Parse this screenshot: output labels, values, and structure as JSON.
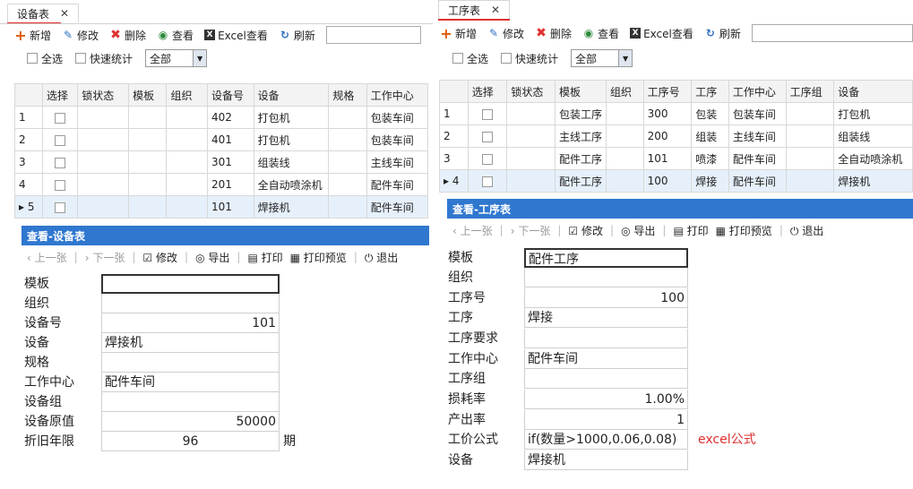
{
  "left": {
    "tab": {
      "title": "设备表",
      "close": "✕"
    },
    "toolbar": {
      "add": "新增",
      "edit": "修改",
      "delete": "删除",
      "view": "查看",
      "excel": "Excel查看",
      "refresh": "刷新"
    },
    "filters": {
      "select_all": "全选",
      "quick_stats": "快速统计",
      "dropdown": "全部"
    },
    "grid": {
      "headers": [
        "",
        "选择",
        "锁状态",
        "模板",
        "组织",
        "设备号",
        "设备",
        "规格",
        "工作中心"
      ],
      "rows": [
        {
          "no": "1",
          "code": "402",
          "name": "打包机",
          "spec": "",
          "center": "包装车间"
        },
        {
          "no": "2",
          "code": "401",
          "name": "打包机",
          "spec": "",
          "center": "包装车间"
        },
        {
          "no": "3",
          "code": "301",
          "name": "组装线",
          "spec": "",
          "center": "主线车间"
        },
        {
          "no": "4",
          "code": "201",
          "name": "全自动喷涂机",
          "spec": "",
          "center": "配件车间"
        },
        {
          "no": "5",
          "code": "101",
          "name": "焊接机",
          "spec": "",
          "center": "配件车间"
        }
      ]
    },
    "dialog": {
      "title": "查看-设备表",
      "nav": {
        "prev": "上一张",
        "next": "下一张",
        "edit": "修改",
        "export": "导出",
        "print": "打印",
        "preview": "打印预览",
        "exit": "退出"
      },
      "fields": [
        {
          "label": "模板",
          "value": ""
        },
        {
          "label": "组织",
          "value": ""
        },
        {
          "label": "设备号",
          "value": "101"
        },
        {
          "label": "设备",
          "value": "焊接机"
        },
        {
          "label": "规格",
          "value": ""
        },
        {
          "label": "工作中心",
          "value": "配件车间"
        },
        {
          "label": "设备组",
          "value": ""
        },
        {
          "label": "设备原值",
          "value": "50000"
        },
        {
          "label": "折旧年限",
          "value": "96"
        }
      ],
      "suffix": "期"
    }
  },
  "right": {
    "tab": {
      "title": "工序表",
      "close": "✕"
    },
    "toolbar": {
      "add": "新增",
      "edit": "修改",
      "delete": "删除",
      "view": "查看",
      "excel": "Excel查看",
      "refresh": "刷新"
    },
    "filters": {
      "select_all": "全选",
      "quick_stats": "快速统计",
      "dropdown": "全部"
    },
    "grid": {
      "headers": [
        "",
        "选择",
        "锁状态",
        "模板",
        "组织",
        "工序号",
        "工序",
        "工作中心",
        "工序组",
        "设备"
      ],
      "rows": [
        {
          "no": "1",
          "template": "包装工序",
          "code": "300",
          "proc": "包装",
          "center": "包装车间",
          "group": "",
          "device": "打包机"
        },
        {
          "no": "2",
          "template": "主线工序",
          "code": "200",
          "proc": "组装",
          "center": "主线车间",
          "group": "",
          "device": "组装线"
        },
        {
          "no": "3",
          "template": "配件工序",
          "code": "101",
          "proc": "喷漆",
          "center": "配件车间",
          "group": "",
          "device": "全自动喷涂机"
        },
        {
          "no": "4",
          "template": "配件工序",
          "code": "100",
          "proc": "焊接",
          "center": "配件车间",
          "group": "",
          "device": "焊接机"
        }
      ]
    },
    "dialog": {
      "title": "查看-工序表",
      "nav": {
        "prev": "上一张",
        "next": "下一张",
        "edit": "修改",
        "export": "导出",
        "print": "打印",
        "preview": "打印预览",
        "exit": "退出"
      },
      "fields": [
        {
          "label": "模板",
          "value": "配件工序"
        },
        {
          "label": "组织",
          "value": ""
        },
        {
          "label": "工序号",
          "value": "100"
        },
        {
          "label": "工序",
          "value": "焊接"
        },
        {
          "label": "工序要求",
          "value": ""
        },
        {
          "label": "工作中心",
          "value": "配件车间"
        },
        {
          "label": "工序组",
          "value": ""
        },
        {
          "label": "损耗率",
          "value": "1.00%"
        },
        {
          "label": "产出率",
          "value": "1"
        },
        {
          "label": "工价公式",
          "value": "if(数量>1000,0.06,0.08)"
        },
        {
          "label": "设备",
          "value": "焊接机"
        }
      ],
      "note": "excel公式"
    }
  }
}
